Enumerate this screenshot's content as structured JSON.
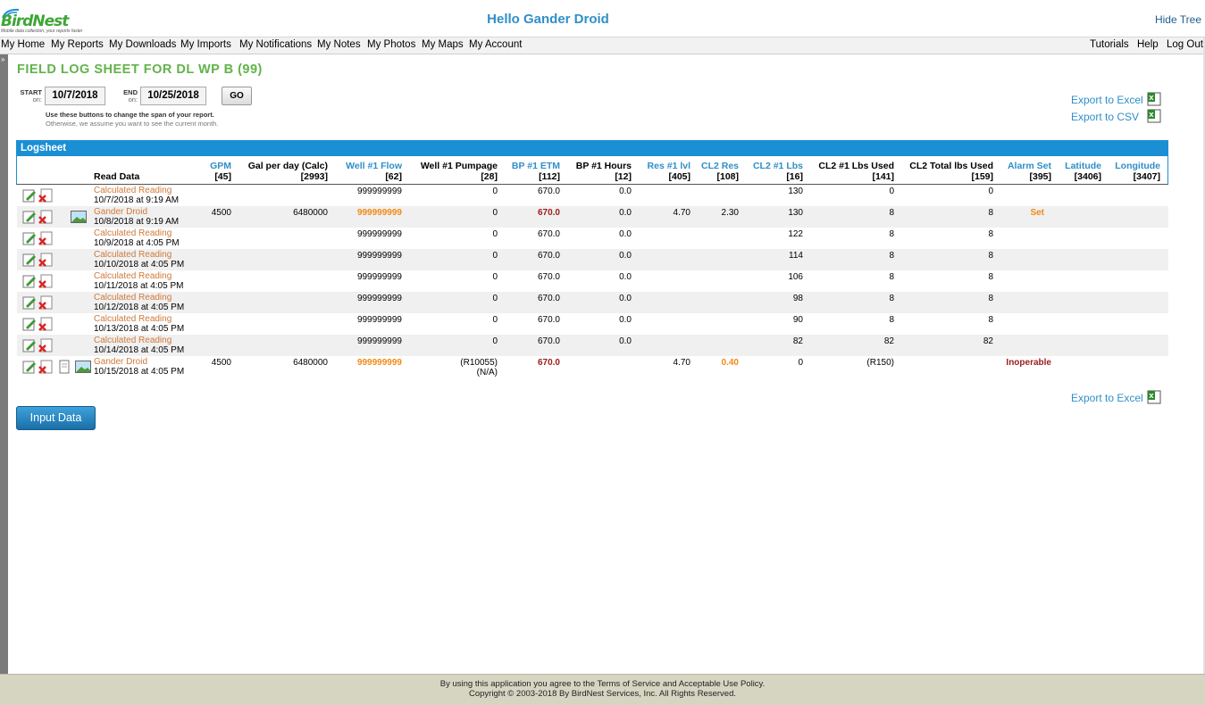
{
  "header": {
    "logo_text": "BirdNest",
    "logo_tagline": "Mobile data collection, your reports faster",
    "greeting": "Hello Gander Droid",
    "hide_tree": "Hide Tree"
  },
  "menu": {
    "left": [
      "My Home",
      "My Reports",
      "My Downloads",
      "My Imports",
      "My Notifications",
      "My Notes",
      "My Photos",
      "My Maps",
      "My Account"
    ],
    "right": [
      "Tutorials",
      "Help",
      "Log Out"
    ]
  },
  "report": {
    "title": "FIELD LOG SHEET FOR DL WP B (99)",
    "start_label": "START",
    "start_sub": "on:",
    "start_value": "10/7/2018",
    "end_label": "END",
    "end_sub": "on:",
    "end_value": "10/25/2018",
    "go_label": "GO",
    "help_line1": "Use these buttons to change the span of your report.",
    "help_line2": "Otherwise, we assume you want to see the current month.",
    "export_excel": "Export to Excel",
    "export_csv": "Export to CSV",
    "export_excel_bottom": "Export to Excel"
  },
  "logsheet": {
    "title": "Logsheet",
    "read_data_header": "Read Data",
    "columns": [
      {
        "label": "GPM",
        "id": "[45]",
        "link": true
      },
      {
        "label": "Gal per day (Calc)",
        "id": "[2993]",
        "link": false
      },
      {
        "label": "Well #1 Flow",
        "id": "[62]",
        "link": true
      },
      {
        "label": "Well #1 Pumpage",
        "id": "[28]",
        "link": false
      },
      {
        "label": "BP #1 ETM",
        "id": "[112]",
        "link": true
      },
      {
        "label": "BP #1 Hours",
        "id": "[12]",
        "link": false
      },
      {
        "label": "Res #1 lvl",
        "id": "[405]",
        "link": true
      },
      {
        "label": "CL2 Res",
        "id": "[108]",
        "link": true
      },
      {
        "label": "CL2 #1 Lbs",
        "id": "[16]",
        "link": true
      },
      {
        "label": "CL2 #1 Lbs Used",
        "id": "[141]",
        "link": false
      },
      {
        "label": "CL2 Total lbs Used",
        "id": "[159]",
        "link": false
      },
      {
        "label": "Alarm Set",
        "id": "[395]",
        "link": true
      },
      {
        "label": "Latitude",
        "id": "[3406]",
        "link": true
      },
      {
        "label": "Longitude",
        "id": "[3407]",
        "link": true
      }
    ],
    "rows": [
      {
        "source": "Calculated Reading",
        "when": "10/7/2018 at 9:19 AM",
        "gpm": "",
        "gpd": "",
        "flow": "999999999",
        "pumpage": "0",
        "etm": "670.0",
        "hours": "0.0",
        "res": "",
        "cl2res": "",
        "cl2lbs": "130",
        "cl2used": "0",
        "cl2total": "0",
        "alarm": "",
        "lat": "",
        "lon": ""
      },
      {
        "source": "Gander Droid",
        "when": "10/8/2018 at 9:19 AM",
        "gpm": "4500",
        "gpd": "6480000",
        "flow": "999999999",
        "pumpage": "0",
        "etm": "670.0",
        "hours": "0.0",
        "res": "4.70",
        "cl2res": "2.30",
        "cl2lbs": "130",
        "cl2used": "8",
        "cl2total": "8",
        "alarm": "Set",
        "lat": "",
        "lon": ""
      },
      {
        "source": "Calculated Reading",
        "when": "10/9/2018 at 4:05 PM",
        "gpm": "",
        "gpd": "",
        "flow": "999999999",
        "pumpage": "0",
        "etm": "670.0",
        "hours": "0.0",
        "res": "",
        "cl2res": "",
        "cl2lbs": "122",
        "cl2used": "8",
        "cl2total": "8",
        "alarm": "",
        "lat": "",
        "lon": ""
      },
      {
        "source": "Calculated Reading",
        "when": "10/10/2018 at 4:05 PM",
        "gpm": "",
        "gpd": "",
        "flow": "999999999",
        "pumpage": "0",
        "etm": "670.0",
        "hours": "0.0",
        "res": "",
        "cl2res": "",
        "cl2lbs": "114",
        "cl2used": "8",
        "cl2total": "8",
        "alarm": "",
        "lat": "",
        "lon": ""
      },
      {
        "source": "Calculated Reading",
        "when": "10/11/2018 at 4:05 PM",
        "gpm": "",
        "gpd": "",
        "flow": "999999999",
        "pumpage": "0",
        "etm": "670.0",
        "hours": "0.0",
        "res": "",
        "cl2res": "",
        "cl2lbs": "106",
        "cl2used": "8",
        "cl2total": "8",
        "alarm": "",
        "lat": "",
        "lon": ""
      },
      {
        "source": "Calculated Reading",
        "when": "10/12/2018 at 4:05 PM",
        "gpm": "",
        "gpd": "",
        "flow": "999999999",
        "pumpage": "0",
        "etm": "670.0",
        "hours": "0.0",
        "res": "",
        "cl2res": "",
        "cl2lbs": "98",
        "cl2used": "8",
        "cl2total": "8",
        "alarm": "",
        "lat": "",
        "lon": ""
      },
      {
        "source": "Calculated Reading",
        "when": "10/13/2018 at 4:05 PM",
        "gpm": "",
        "gpd": "",
        "flow": "999999999",
        "pumpage": "0",
        "etm": "670.0",
        "hours": "0.0",
        "res": "",
        "cl2res": "",
        "cl2lbs": "90",
        "cl2used": "8",
        "cl2total": "8",
        "alarm": "",
        "lat": "",
        "lon": ""
      },
      {
        "source": "Calculated Reading",
        "when": "10/14/2018 at 4:05 PM",
        "gpm": "",
        "gpd": "",
        "flow": "999999999",
        "pumpage": "0",
        "etm": "670.0",
        "hours": "0.0",
        "res": "",
        "cl2res": "",
        "cl2lbs": "82",
        "cl2used": "82",
        "cl2total": "82",
        "alarm": "",
        "lat": "",
        "lon": ""
      },
      {
        "source": "Gander Droid",
        "when": "10/15/2018 at 4:05 PM",
        "gpm": "4500",
        "gpd": "6480000",
        "flow": "999999999",
        "pumpage": "(R10055)",
        "pumpage2": "(N/A)",
        "etm": "670.0",
        "hours": "",
        "res": "4.70",
        "cl2res": "0.40",
        "cl2lbs": "0",
        "cl2used": "(R150)",
        "cl2total": "",
        "alarm": "Inoperable",
        "lat": "",
        "lon": ""
      }
    ]
  },
  "input_data_label": "Input Data",
  "footer": {
    "line1": "By using this application you agree to the Terms of Service and Acceptable Use Policy.",
    "line2": "Copyright © 2003-2018 By BirdNest Services, Inc. All Rights Reserved."
  },
  "colors": {
    "accent_blue": "#1b8fd3",
    "title_green": "#62b34a",
    "source_orange": "#d07a3a",
    "highlight_orange": "#f08a16",
    "alert_red": "#9b1c1c"
  },
  "icons": [
    "edit-icon",
    "delete-icon",
    "note-icon",
    "photo-icon",
    "excel-icon"
  ]
}
